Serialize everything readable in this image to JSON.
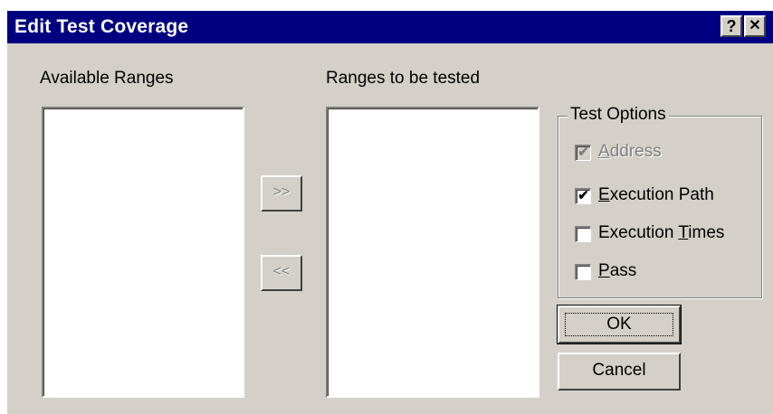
{
  "dialog": {
    "title": "Edit Test Coverage",
    "help_button": "?",
    "close_button": "✕"
  },
  "available_ranges": {
    "label": "Available Ranges",
    "items": []
  },
  "ranges_to_test": {
    "label": "Ranges to be tested",
    "items": []
  },
  "move_buttons": {
    "add_label": ">>",
    "remove_label": "<<"
  },
  "test_options": {
    "legend": "Test Options",
    "options": [
      {
        "pre": "",
        "key": "A",
        "post": "ddress",
        "checked": true,
        "disabled": true
      },
      {
        "pre": "",
        "key": "E",
        "post": "xecution Path",
        "checked": true,
        "disabled": false
      },
      {
        "pre": "Execution ",
        "key": "T",
        "post": "imes",
        "checked": false,
        "disabled": false
      },
      {
        "pre": "",
        "key": "P",
        "post": "ass",
        "checked": false,
        "disabled": false
      }
    ]
  },
  "buttons": {
    "ok_label": "OK",
    "cancel_label": "Cancel"
  },
  "colors": {
    "face": "#d4d0c8",
    "titlebar": "#000080",
    "disabled_text": "#808080"
  }
}
